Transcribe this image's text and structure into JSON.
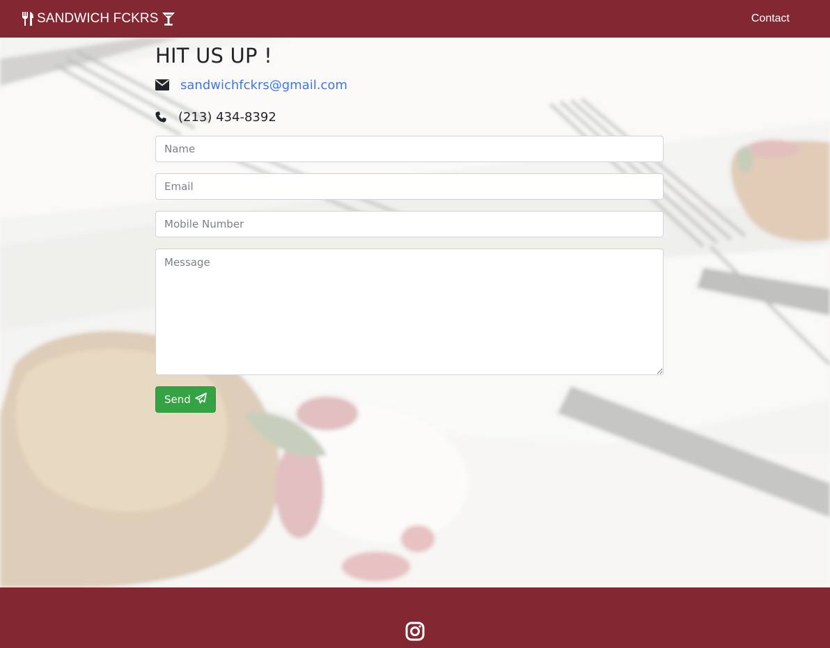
{
  "navbar": {
    "brand_text": "SANDWICH FCKRS",
    "brand_left_icon": "utensils-icon",
    "brand_right_icon": "cocktail-glass-icon",
    "contact_link": "Contact"
  },
  "contact": {
    "heading": "HIT US UP !",
    "email": "sandwichfckrs@gmail.com",
    "phone": "(213) 434-8392",
    "email_icon": "envelope-icon",
    "phone_icon": "phone-icon"
  },
  "form": {
    "name_placeholder": "Name",
    "email_placeholder": "Email",
    "mobile_placeholder": "Mobile Number",
    "message_placeholder": "Message",
    "send_label": "Send",
    "send_icon": "paper-plane-icon"
  },
  "footer": {
    "social_icon": "instagram-icon"
  },
  "colors": {
    "brand": "#832833",
    "link": "#3d78e8",
    "send_button": "#33a344"
  }
}
